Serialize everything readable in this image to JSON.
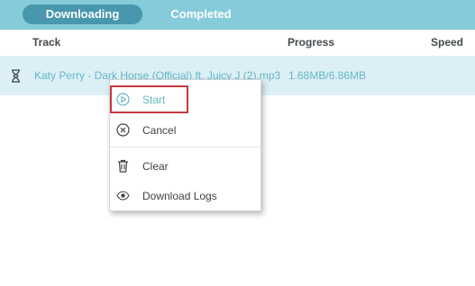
{
  "tabs": {
    "downloading": "Downloading",
    "completed": "Completed"
  },
  "columns": {
    "track": "Track",
    "progress": "Progress",
    "speed": "Speed"
  },
  "download_row": {
    "status_icon": "hourglass-icon",
    "track_name": "Katy Perry - Dark Horse (Official) ft. Juicy J (2).mp3",
    "progress": "1.68MB/6.86MB"
  },
  "context_menu": {
    "start": {
      "label": "Start",
      "icon": "play-circle-icon"
    },
    "cancel": {
      "label": "Cancel",
      "icon": "x-circle-icon"
    },
    "clear": {
      "label": "Clear",
      "icon": "trash-icon"
    },
    "logs": {
      "label": "Download Logs",
      "icon": "eye-icon"
    }
  },
  "colors": {
    "tabbar": "#85cbd9",
    "active_tab": "#4797ae",
    "row_highlight": "#dceff4",
    "accent_text": "#63b8c7",
    "highlight_outline": "#c43a3c"
  }
}
